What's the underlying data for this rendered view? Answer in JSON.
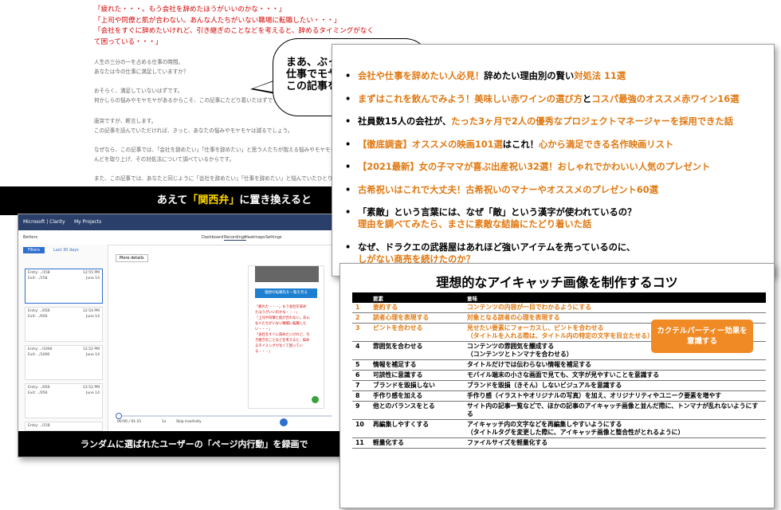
{
  "article": {
    "quotes": [
      "「疲れた・・・。もう会社を辞めたほうがいいのかな・・・」",
      "「上司や同僚と肌が合わない。あんな人たちがいない職場に転職したい・・・」",
      "「会社をすぐに辞めたいけれど、引き継ぎのことなどを考えると、辞めるタイミングがなく",
      "て困っている・・・」"
    ],
    "paragraphs": [
      "人生の三分の一を占める仕事の時間。",
      "あなたは今の仕事に満足していますか？",
      "おそらく、満足していないはずです。",
      "何かしらの悩みやモヤモヤがあるからこそ、この記事にたどり着いたはずです。",
      "唐突ですが、断言します。",
      "この記事を読んでいただければ、きっと、あなたの悩みやモヤモヤは減るでしょう。",
      "なぜなら、この記事では、「会社を辞めたい」「仕事を辞めたい」と思う人たちが抱える悩みやモヤモヤ",
      "んどを取り上げ、その対処法について調べているからです。",
      "また、この記事では、あなたと同じように「会社を辞めたい」「仕事を辞めたい」と悩んでいたひとりの"
    ],
    "bubble": [
      "まあ、ぶっ",
      "仕事でモヤ",
      "この記事を"
    ],
    "banner": {
      "pre": "あえて",
      "hl": "「関西弁」",
      "post": "に置き換えると"
    }
  },
  "clarity": {
    "brand": "Microsoft | Clarity",
    "project": "My Projects",
    "site": "Bettors",
    "tabs": [
      "Dashboard",
      "Recordings",
      "Heatmaps",
      "Settings"
    ],
    "filters": "Filters",
    "range": "Last 30 days",
    "more": "More details",
    "entries": [
      {
        "t1": "Entry: ../158",
        "t2": "Exit: ../158",
        "time": "12:55 PM",
        "date": "June 14"
      },
      {
        "t1": "Entry: ../056",
        "t2": "Exit: ../056",
        "time": "12:54 PM",
        "date": "June 14"
      },
      {
        "t1": "Entry: ../1000",
        "t2": "Exit: ../1000",
        "time": "12:52 PM",
        "date": "June 14"
      },
      {
        "t1": "Entry: ../056",
        "t2": "Exit: ../056",
        "time": "12:52 PM",
        "date": "June 14"
      },
      {
        "t1": "Entry: ../158",
        "t2": "Exit: ../2438",
        "time": "12:50 PM",
        "date": "June 14"
      }
    ],
    "cta": "理想の転職先を一覧を見る",
    "red_quote": [
      "「疲れた・・・。もう会社を辞め",
      "たほうがいいのかな・・・」",
      "「上司や同僚と肌が合わない。あん",
      "な人たちがいない職場に転職した",
      "い・・・」",
      "「会社をすぐに辞めたいけれど、引",
      "き継ぎのことなどを考えると、辞め",
      "るタイミングがなくて困ってい",
      "る・・・」"
    ],
    "time": "00:00 / 01:21",
    "speed": "1x",
    "skip": "Skip inactivity",
    "banner": "ランダムに選ばれたユーザーの「ページ内行動」を録画で"
  },
  "list": [
    [
      {
        "t": "会社や仕事を辞めたい人必見！",
        "c": "o"
      },
      {
        "t": "辞めたい理由別の賢い",
        "c": "k"
      },
      {
        "t": "対処法 11選",
        "c": "o"
      }
    ],
    [
      {
        "t": "まずはこれを飲んでみよう！美味しい赤ワインの選び方",
        "c": "o"
      },
      {
        "t": "と",
        "c": "k"
      },
      {
        "t": "コスパ最強のオススメ赤ワイン16選",
        "c": "o"
      }
    ],
    [
      {
        "t": "社員数15人の会社が、",
        "c": "k"
      },
      {
        "t": "たった3ヶ月で2人の優秀なプロジェクトマネージャーを採用できた話",
        "c": "o"
      }
    ],
    [
      {
        "t": "【徹底調査】オススメの映画101選",
        "c": "o"
      },
      {
        "t": "はこれ！",
        "c": "k"
      },
      {
        "t": "心から満足できる名作映画リスト",
        "c": "o"
      }
    ],
    [
      {
        "t": "【2021最新】女の子ママが喜ぶ出産祝い32選！おしゃれでかわいい人気のプレゼント",
        "c": "o"
      }
    ],
    [
      {
        "t": "古希祝いはこれで大丈夫！古希祝いのマナーやオススメのプレゼント60選",
        "c": "o"
      }
    ],
    [
      {
        "t": "「素敵」という言葉には、なぜ「敵」という漢字が使われているの？",
        "c": "k"
      }
    ],
    [
      {
        "t": "なぜ、ドラクエの武器屋はあれほど強いアイテムを売っているのに、",
        "c": "k"
      }
    ]
  ],
  "list_second_lines": {
    "6": "理由を調べてみたら、まさに素敵な結論にたどり着いた話",
    "7": "しがない商売を続けたのか？"
  },
  "tips": {
    "title": "理想的なアイキャッチ画像を制作するコツ",
    "headers": [
      "要素",
      "意味"
    ],
    "rows": [
      {
        "n": "1",
        "e": "要約する",
        "m": "コンテンツの内容が一目でわかるようにする",
        "red": true
      },
      {
        "n": "2",
        "e": "読者心理を表現する",
        "m": "対象となる読者の心理を表現する",
        "red": true
      },
      {
        "n": "3",
        "e": "ピントを合わせる",
        "m": "見せたい要素にフォーカスし、ピントを合わせる\n（タイトルを入れる際は、タイトル内の特定の文字を目立たせる）",
        "red": true
      },
      {
        "n": "4",
        "e": "雰囲気を合わせる",
        "m": "コンテンツの雰囲気を醸成する\n（コンテンツとトンマナを合わせる）",
        "red": false
      },
      {
        "n": "5",
        "e": "情報を補足する",
        "m": "タイトルだけでは伝わらない情報を補足する",
        "red": false
      },
      {
        "n": "6",
        "e": "可読性に意識する",
        "m": "モバイル端末の小さな画面で見ても、文字が見やすいことを意識する",
        "red": false
      },
      {
        "n": "7",
        "e": "ブランドを毀損しない",
        "m": "ブランドを毀損（きそん）しないビジュアルを意識する",
        "red": false
      },
      {
        "n": "8",
        "e": "手作り感を加える",
        "m": "手作り感（イラストやオリジナルの写真）を加え、オリジナリティやユニーク要素を増やす",
        "red": false
      },
      {
        "n": "9",
        "e": "他とのバランスをとる",
        "m": "サイト内の記事一覧などで、ほかの記事のアイキャッチ画像と並んだ際に、トンマナが乱れないようにする",
        "red": false
      },
      {
        "n": "10",
        "e": "再編集しやすくする",
        "m": "アイキャッチ内の文字などを再編集しやすいようにする\n（タイトルタグを変更した際に、アイキャッチ画像と整合性がとれるように）",
        "red": false
      },
      {
        "n": "11",
        "e": "軽量化する",
        "m": "ファイルサイズを軽量化する",
        "red": false
      }
    ],
    "tag": "カクテルパーティー効果を\n意識する"
  },
  "colors": {
    "orange": "#e07810",
    "red": "#d40000",
    "navy": "#2a3f6a",
    "tag": "#f08a24"
  }
}
